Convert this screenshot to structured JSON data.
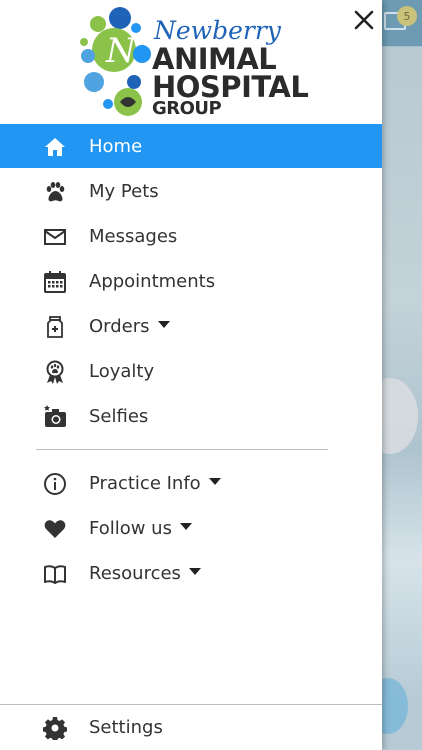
{
  "background_app": {
    "badge_count": "5"
  },
  "logo": {
    "script_text": "Newberry",
    "line1": "ANIMAL",
    "line2": "HOSPITAL",
    "line3": "GROUP"
  },
  "menu": {
    "items": [
      {
        "label": "Home",
        "icon": "home-icon",
        "active": true
      },
      {
        "label": "My Pets",
        "icon": "paw-icon"
      },
      {
        "label": "Messages",
        "icon": "envelope-icon"
      },
      {
        "label": "Appointments",
        "icon": "calendar-icon"
      },
      {
        "label": "Orders",
        "icon": "medicine-bottle-icon",
        "has_dropdown": true
      },
      {
        "label": "Loyalty",
        "icon": "award-ribbon-icon"
      },
      {
        "label": "Selfies",
        "icon": "camera-icon"
      }
    ],
    "secondary": [
      {
        "label": "Practice Info",
        "icon": "info-icon",
        "has_dropdown": true
      },
      {
        "label": "Follow us",
        "icon": "heart-icon",
        "has_dropdown": true
      },
      {
        "label": "Resources",
        "icon": "book-icon",
        "has_dropdown": true
      }
    ],
    "footer": {
      "label": "Settings",
      "icon": "gear-icon"
    }
  },
  "colors": {
    "accent": "#2196f3",
    "logo_blue": "#1e63b8",
    "logo_green": "#8bc34a"
  }
}
